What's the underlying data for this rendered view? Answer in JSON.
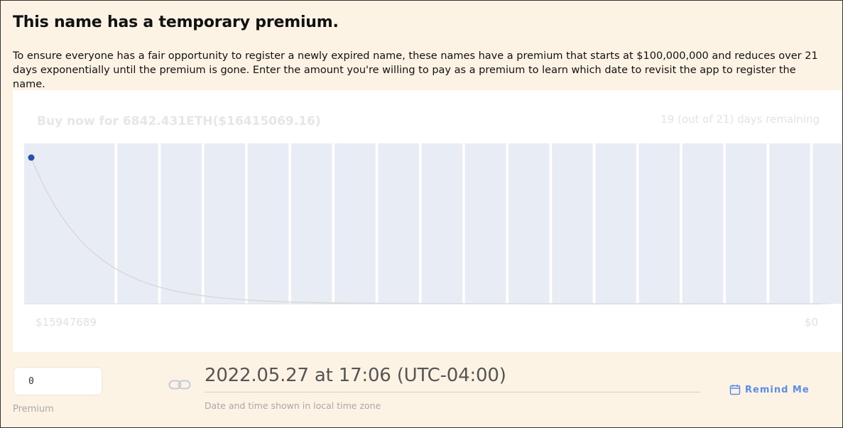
{
  "header": {
    "title": "This name has a temporary premium.",
    "description": "To ensure everyone has a fair opportunity to register a newly expired name, these names have a premium that starts at $100,000,000 and reduces over 21 days exponentially until the premium is gone. Enter the amount you're willing to pay as a premium to learn which date to revisit the app to register the name."
  },
  "chart": {
    "buy_now": "Buy now for 6842.431ETH($16415069.16)",
    "days_remaining": "19 (out of 21) days remaining",
    "y_start_label": "$15947689",
    "y_end_label": "$0",
    "colors": {
      "bar": "#e8ecf5",
      "curve": "#d9d9d9",
      "marker": "#2c4fa8"
    }
  },
  "chart_data": {
    "type": "line",
    "total_days": 21,
    "days_remaining": 19,
    "x": [
      0,
      21
    ],
    "series": [
      {
        "values": [
          15947689,
          0
        ]
      }
    ],
    "title": "",
    "xlabel": "",
    "ylabel": ""
  },
  "form": {
    "premium_value": "0",
    "premium_label": "Premium",
    "datetime": "2022.05.27 at 17:06 (UTC-04:00)",
    "timezone_note": "Date and time shown in local time zone",
    "remind_label": "Remind Me",
    "link_icon": "link-icon",
    "calendar_icon": "calendar-icon",
    "accent_color": "#5b8de8"
  }
}
